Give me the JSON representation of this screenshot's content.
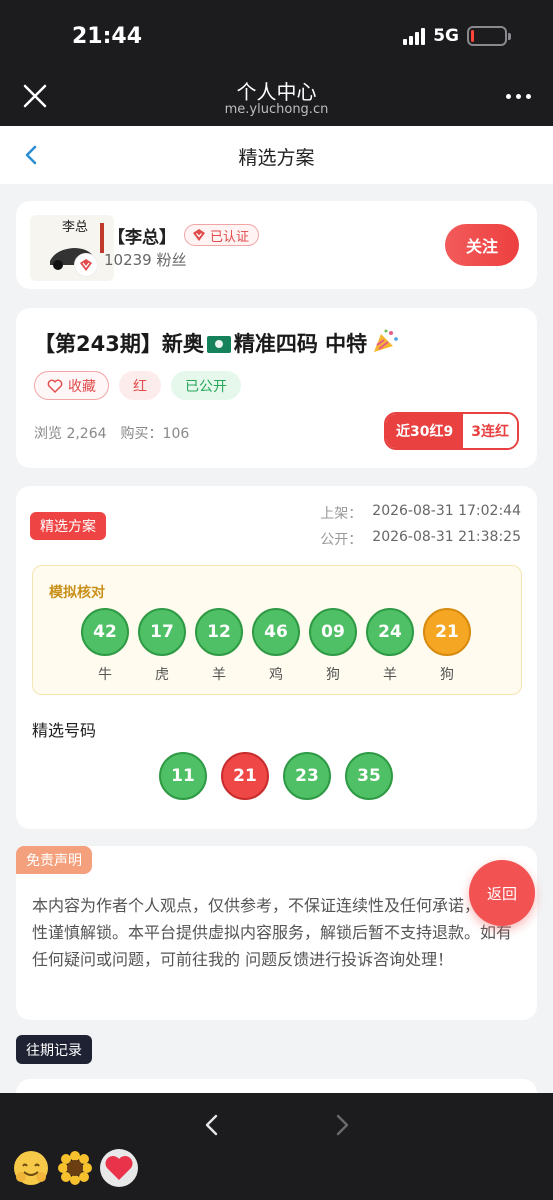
{
  "status_bar": {
    "time": "21:44",
    "network": "5G"
  },
  "browser": {
    "title": "个人中心",
    "url": "me.yluchong.cn"
  },
  "page": {
    "title": "精选方案"
  },
  "author": {
    "name": "【李总】",
    "verified": "已认证",
    "fans": "10239 粉丝",
    "follow": "关注",
    "avatar_text": "李总"
  },
  "post": {
    "title": "【第243期】新奥",
    "title_suffix": "精准四码 中特",
    "tags": {
      "favorite": "收藏",
      "red": "红",
      "public": "已公开"
    },
    "views": "浏览 2,264",
    "buys": "购买：106",
    "streak_recent": "近30红9",
    "streak_consecutive": "3连红"
  },
  "plan": {
    "label": "精选方案",
    "listed_key": "上架：",
    "listed_time": "2026-08-31 17:02:44",
    "public_key": "公开：",
    "public_time": "2026-08-31 21:38:25",
    "simulation_title": "模拟核对",
    "balls": [
      {
        "number": "42",
        "zodiac": "牛",
        "color": "green"
      },
      {
        "number": "17",
        "zodiac": "虎",
        "color": "green"
      },
      {
        "number": "12",
        "zodiac": "羊",
        "color": "green"
      },
      {
        "number": "46",
        "zodiac": "鸡",
        "color": "green"
      },
      {
        "number": "09",
        "zodiac": "狗",
        "color": "green"
      },
      {
        "number": "24",
        "zodiac": "羊",
        "color": "green"
      },
      {
        "number": "21",
        "zodiac": "狗",
        "color": "orange"
      }
    ],
    "picks_title": "精选号码",
    "picks": [
      {
        "number": "11",
        "color": "green"
      },
      {
        "number": "21",
        "color": "red"
      },
      {
        "number": "23",
        "color": "green"
      },
      {
        "number": "35",
        "color": "green"
      }
    ]
  },
  "disclaimer": {
    "label": "免责声明",
    "text": "本内容为作者个人观点，仅供参考，不保证连续性及任何承诺，请理性谨慎解锁。本平台提供虚拟内容服务，解锁后暂不支持退款。如有任何疑问或问题，可前往我的 问题反馈进行投诉咨询处理！"
  },
  "return_button": "返回",
  "history": {
    "label": "往期记录"
  },
  "colors": {
    "accent_red": "#ef4444",
    "ball_green": "#4fc065",
    "ball_orange": "#f5a623",
    "dark_bar": "#1c1c1e"
  }
}
